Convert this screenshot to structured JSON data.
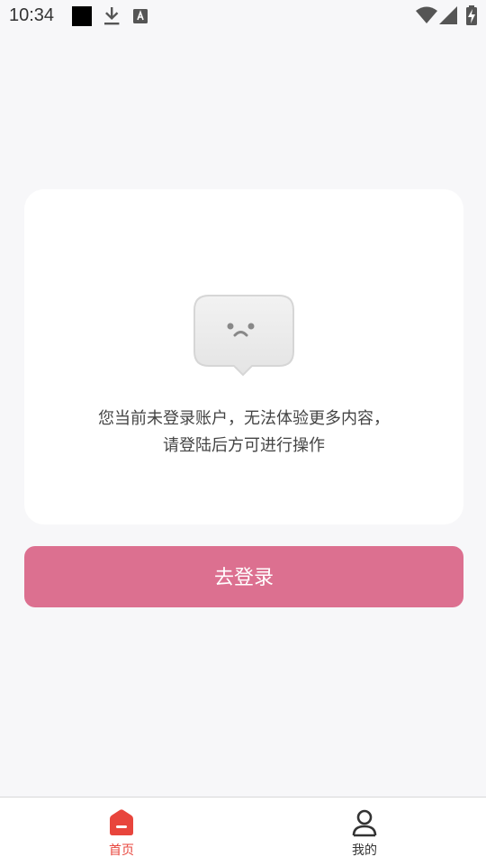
{
  "status_bar": {
    "time": "10:34",
    "icons": [
      "black-square-icon",
      "download-icon",
      "a-badge-icon",
      "wifi-icon",
      "cell-signal-icon",
      "battery-charging-icon"
    ]
  },
  "empty_state": {
    "icon": "sad-face-speech-bubble",
    "message_line1": "您当前未登录账户，无法体验更多内容，",
    "message_line2": "请登陆后方可进行操作"
  },
  "login_button": {
    "label": "去登录",
    "color": "#dc7090"
  },
  "tab_bar": {
    "items": [
      {
        "label": "首页",
        "icon": "home-icon",
        "active": true,
        "color": "#e8453c"
      },
      {
        "label": "我的",
        "icon": "user-icon",
        "active": false,
        "color": "#333333"
      }
    ]
  }
}
